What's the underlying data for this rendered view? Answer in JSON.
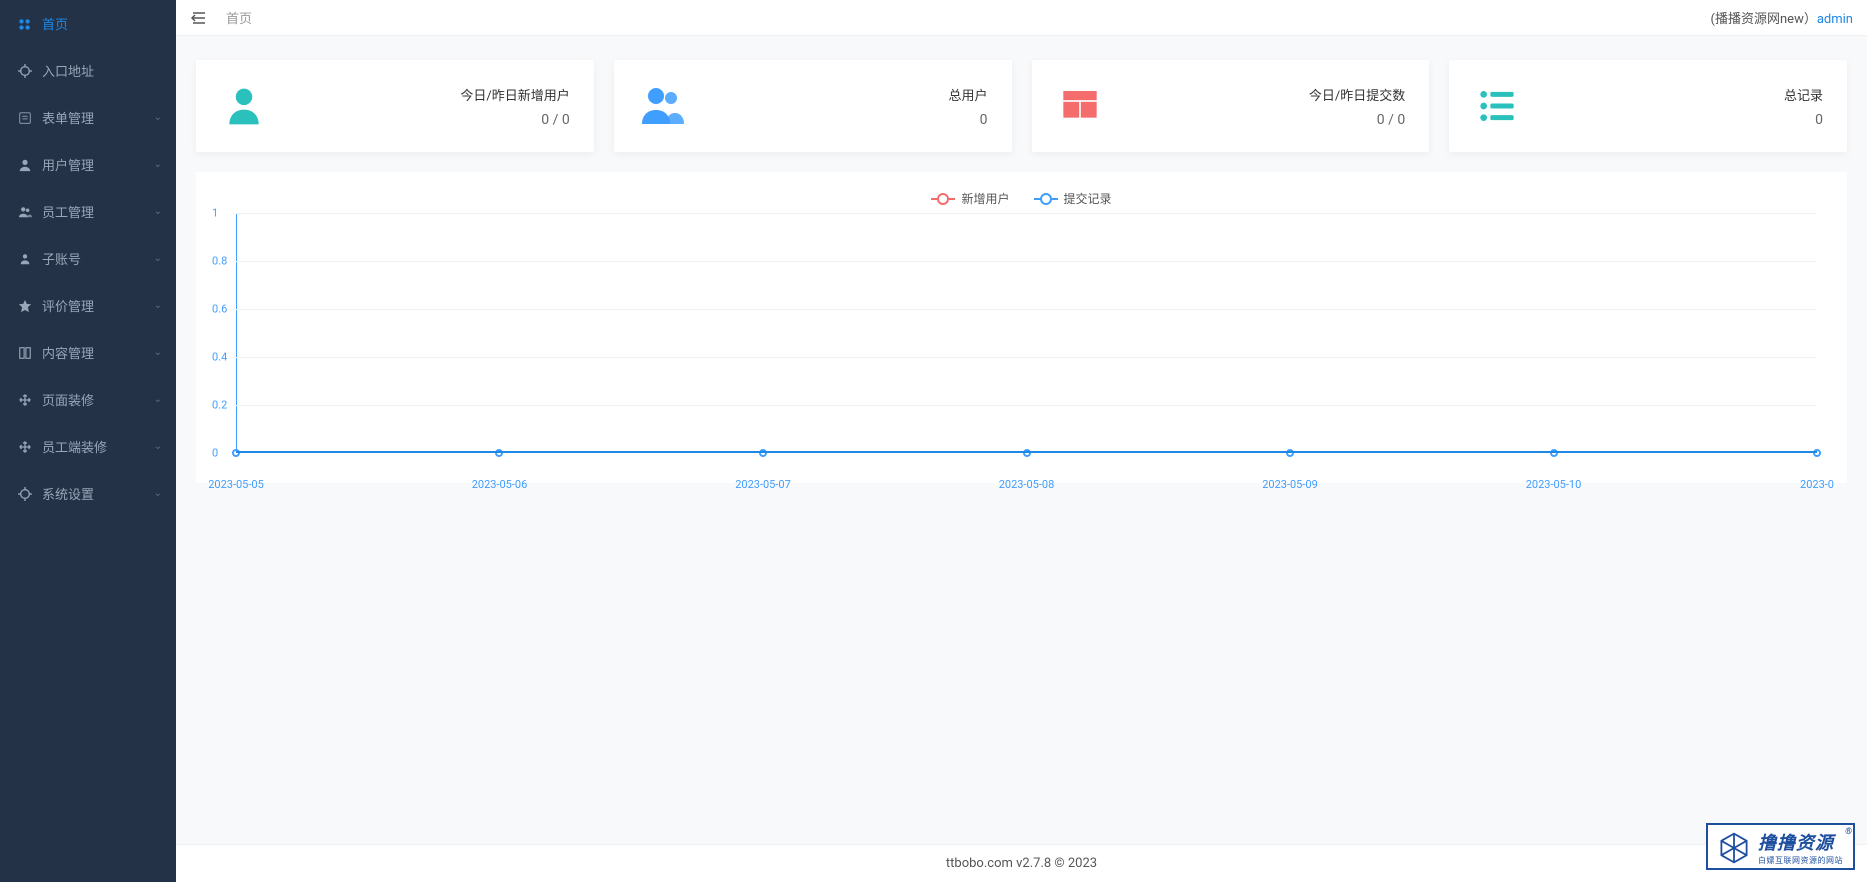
{
  "sidebar": {
    "items": [
      {
        "label": "首页",
        "icon": "dashboard",
        "active": true,
        "expandable": false
      },
      {
        "label": "入口地址",
        "icon": "target",
        "active": false,
        "expandable": false
      },
      {
        "label": "表单管理",
        "icon": "form",
        "active": false,
        "expandable": true
      },
      {
        "label": "用户管理",
        "icon": "user",
        "active": false,
        "expandable": true
      },
      {
        "label": "员工管理",
        "icon": "users",
        "active": false,
        "expandable": true
      },
      {
        "label": "子账号",
        "icon": "account",
        "active": false,
        "expandable": true
      },
      {
        "label": "评价管理",
        "icon": "star",
        "active": false,
        "expandable": true
      },
      {
        "label": "内容管理",
        "icon": "content",
        "active": false,
        "expandable": true
      },
      {
        "label": "页面装修",
        "icon": "move",
        "active": false,
        "expandable": true
      },
      {
        "label": "员工端装修",
        "icon": "move",
        "active": false,
        "expandable": true
      },
      {
        "label": "系统设置",
        "icon": "settings",
        "active": false,
        "expandable": true
      }
    ]
  },
  "topbar": {
    "breadcrumb": "首页",
    "site_name_prefix": "(播播资源网new）",
    "user": "admin"
  },
  "cards": [
    {
      "icon": "person",
      "color": "#2ac1bc",
      "title": "今日/昨日新增用户",
      "value": "0 / 0"
    },
    {
      "icon": "people",
      "color": "#409eff",
      "title": "总用户",
      "value": "0"
    },
    {
      "icon": "grid",
      "color": "#f56c6c",
      "title": "今日/昨日提交数",
      "value": "0 / 0"
    },
    {
      "icon": "list",
      "color": "#2ac1bc",
      "title": "总记录",
      "value": "0"
    }
  ],
  "chart_data": {
    "type": "line",
    "title": "",
    "xlabel": "",
    "ylabel": "",
    "ylim": [
      0,
      1
    ],
    "y_ticks": [
      0,
      0.2,
      0.4,
      0.6,
      0.8,
      1
    ],
    "categories": [
      "2023-05-05",
      "2023-05-06",
      "2023-05-07",
      "2023-05-08",
      "2023-05-09",
      "2023-05-10",
      "2023-0"
    ],
    "series": [
      {
        "name": "新增用户",
        "color": "#f56c6c",
        "values": [
          0,
          0,
          0,
          0,
          0,
          0,
          0
        ]
      },
      {
        "name": "提交记录",
        "color": "#409eff",
        "values": [
          0,
          0,
          0,
          0,
          0,
          0,
          0
        ]
      }
    ]
  },
  "footer": {
    "text": "ttbobo.com v2.7.8 © 2023"
  },
  "watermark": {
    "title": "撸撸资源",
    "reg": "®",
    "subtitle": "白嫖互联网资源的网站"
  }
}
